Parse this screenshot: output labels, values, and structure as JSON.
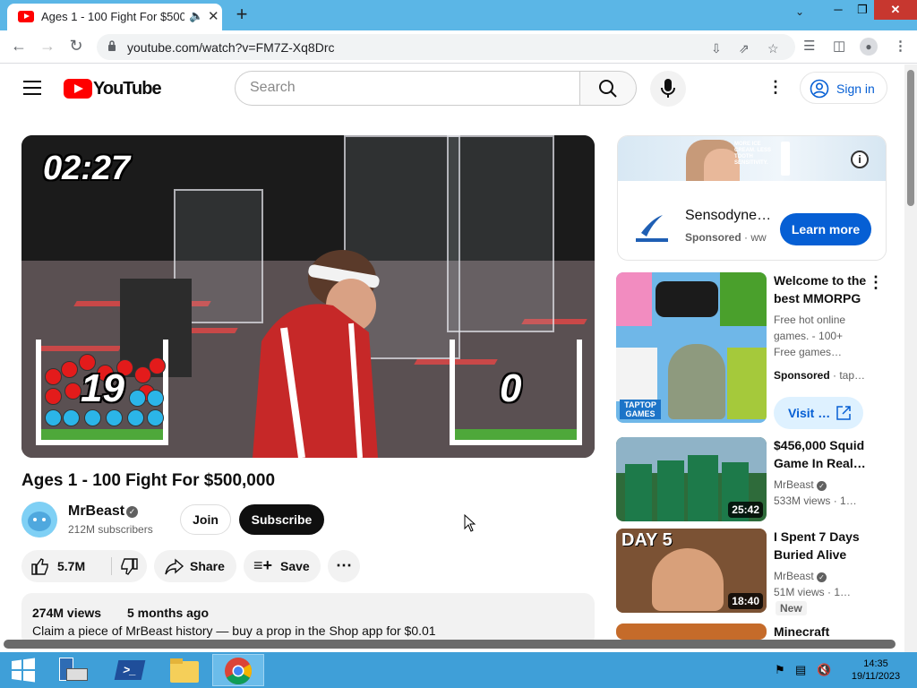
{
  "browser": {
    "tab_title": "Ages 1 - 100 Fight For $500,0",
    "url": "youtube.com/watch?v=FM7Z-Xq8Drc"
  },
  "youtube": {
    "logo_text": "YouTube",
    "search_placeholder": "Search",
    "signin_label": "Sign in"
  },
  "video": {
    "timer_overlay": "02:27",
    "score_left": "19",
    "score_right": "0",
    "title": "Ages 1 - 100 Fight For $500,000",
    "channel_name": "MrBeast",
    "subscribers": "212M subscribers",
    "join_label": "Join",
    "subscribe_label": "Subscribe",
    "likes": "5.7M",
    "share_label": "Share",
    "save_label": "Save",
    "views": "274M views",
    "uploaded": "5 months ago",
    "description_line": "Claim a piece of MrBeast history — buy a prop in the Shop app for $0.01"
  },
  "sidebar": {
    "ad": {
      "title": "Sensodyne…",
      "sponsored": "Sponsored",
      "domain_fragment": "· ww",
      "cta": "Learn more",
      "banner_text": "MORE ICE CREAM. LESS TOOTH SENSITIVITY."
    },
    "items": [
      {
        "title_line1": "Welcome to the",
        "title_line2": "best MMORPG",
        "sub1": "Free hot online",
        "sub2": "games. - 100+",
        "sub3": "Free games…",
        "sponsored": "Sponsored",
        "sponsor_suffix": "· tap…",
        "visit_label": "Visit …",
        "thumb_label": "TAPTOP GAMES"
      },
      {
        "title_line1": "$456,000 Squid",
        "title_line2": "Game In Real…",
        "channel": "MrBeast",
        "meta": "533M views",
        "meta_suffix": "· 1…",
        "duration": "25:42"
      },
      {
        "title_line1": "I Spent 7 Days",
        "title_line2": "Buried Alive",
        "channel": "MrBeast",
        "meta": "51M views",
        "meta_suffix": "· 1…",
        "badge": "New",
        "duration": "18:40",
        "thumb_label": "DAY 5"
      },
      {
        "title_line1": "Minecraft"
      }
    ]
  },
  "taskbar": {
    "time": "14:35",
    "date": "19/11/2023"
  },
  "colors": {
    "tabstrip": "#5bb6e6",
    "youtube_red": "#ff0000",
    "link_blue": "#065fd4",
    "taskbar": "#3f9fd8"
  }
}
